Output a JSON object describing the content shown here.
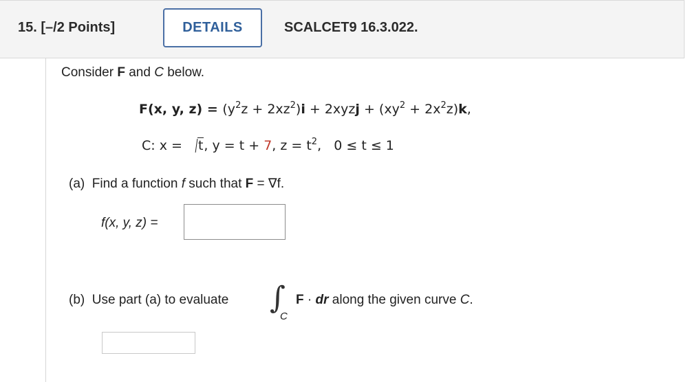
{
  "header": {
    "question_number": "15.",
    "points": "[–/2 Points]",
    "details_label": "DETAILS",
    "problem_code": "SCALCET9 16.3.022."
  },
  "question": {
    "intro_prefix": "Consider ",
    "intro_F": "F",
    "intro_mid": " and ",
    "intro_C": "C",
    "intro_suffix": " below.",
    "field": {
      "lhs": "F(x, y, z) = ",
      "t1": "(y",
      "e1": "2",
      "t2": "z + 2xz",
      "e2": "2",
      "t3": ")",
      "i": "i",
      "t4": " + 2xyz",
      "j": "j",
      "t5": " + (xy",
      "e3": "2",
      "t6": " + 2x",
      "e4": "2",
      "t7": "z)",
      "k": "k",
      "t8": ","
    },
    "curve": {
      "lhs": "C: x = ",
      "sqrt_arg": "t",
      "t1": ", y = t + ",
      "const": "7",
      "t2": ", z = t",
      "e1": "2",
      "t3": ",   0 ≤ t ≤ 1"
    },
    "part_a": {
      "label": "(a)",
      "text_prefix": "  Find a function ",
      "f": "f",
      "text_mid": " such that ",
      "F": "F",
      "text_suffix": " = ∇f.",
      "answer_label": "f(x, y, z) ="
    },
    "part_b": {
      "label": "(b)",
      "text_prefix": "  Use part (a) to evaluate",
      "integral_symbol": "∫",
      "integral_sub": "C",
      "F": "F",
      "dot": " · ",
      "dr": "dr",
      "text_suffix": " along the given curve ",
      "C": "C",
      "period": "."
    }
  },
  "colors": {
    "accent_button": "#2f5f9a",
    "highlight_constant": "#c0392b"
  }
}
